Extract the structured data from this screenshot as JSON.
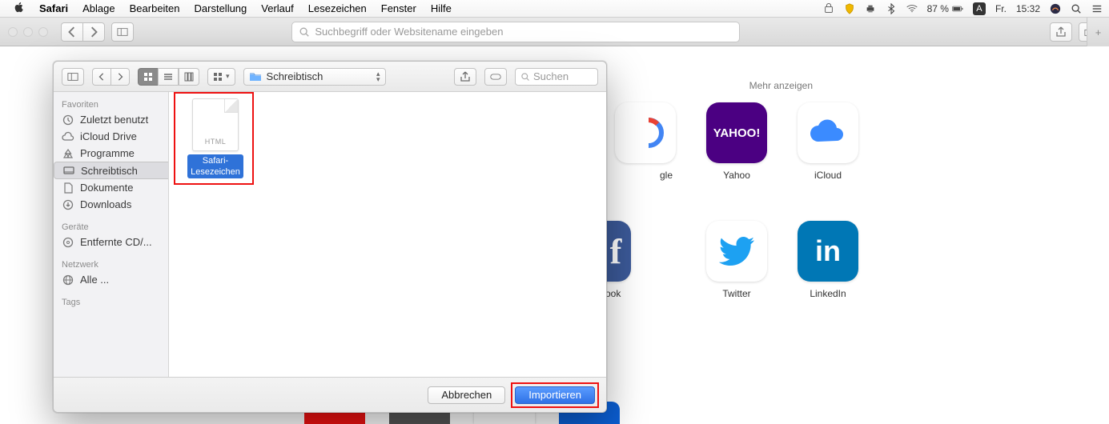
{
  "menubar": {
    "app": "Safari",
    "items": [
      "Ablage",
      "Bearbeiten",
      "Darstellung",
      "Verlauf",
      "Lesezeichen",
      "Fenster",
      "Hilfe"
    ],
    "status": {
      "battery_pct": "87 %",
      "day": "Fr.",
      "time": "15:32",
      "input": "A"
    }
  },
  "toolbar": {
    "address_placeholder": "Suchbegriff oder Websitename eingeben"
  },
  "startpage": {
    "show_more": "Mehr anzeigen",
    "tiles": [
      {
        "label": "",
        "partial": "gle",
        "bg": "#fff"
      },
      {
        "label": "Yahoo",
        "logo": "YAHOO!",
        "bg": "#4b0082"
      },
      {
        "label": "iCloud",
        "logo": "cloud",
        "bg": "#fff"
      },
      {
        "label": "ook",
        "logo": "f",
        "bg": "#3b5998",
        "partial": true
      },
      {
        "label": "Twitter",
        "logo": "tw",
        "bg": "#fff"
      },
      {
        "label": "LinkedIn",
        "logo": "in",
        "bg": "#0077b5"
      }
    ]
  },
  "sheet": {
    "path_label": "Schreibtisch",
    "search_placeholder": "Suchen",
    "sidebar": {
      "sections": [
        {
          "header": "Favoriten",
          "items": [
            {
              "icon": "clock",
              "label": "Zuletzt benutzt"
            },
            {
              "icon": "cloud",
              "label": "iCloud Drive"
            },
            {
              "icon": "apps",
              "label": "Programme"
            },
            {
              "icon": "desktop",
              "label": "Schreibtisch",
              "selected": true
            },
            {
              "icon": "doc",
              "label": "Dokumente"
            },
            {
              "icon": "download",
              "label": "Downloads"
            }
          ]
        },
        {
          "header": "Geräte",
          "items": [
            {
              "icon": "disc",
              "label": "Entfernte CD/..."
            }
          ]
        },
        {
          "header": "Netzwerk",
          "items": [
            {
              "icon": "globe",
              "label": "Alle ..."
            }
          ]
        },
        {
          "header": "Tags",
          "items": []
        }
      ]
    },
    "file": {
      "name": "Safari-\nLesezeichen",
      "ext": "HTML"
    },
    "buttons": {
      "cancel": "Abbrechen",
      "confirm": "Importieren"
    }
  }
}
